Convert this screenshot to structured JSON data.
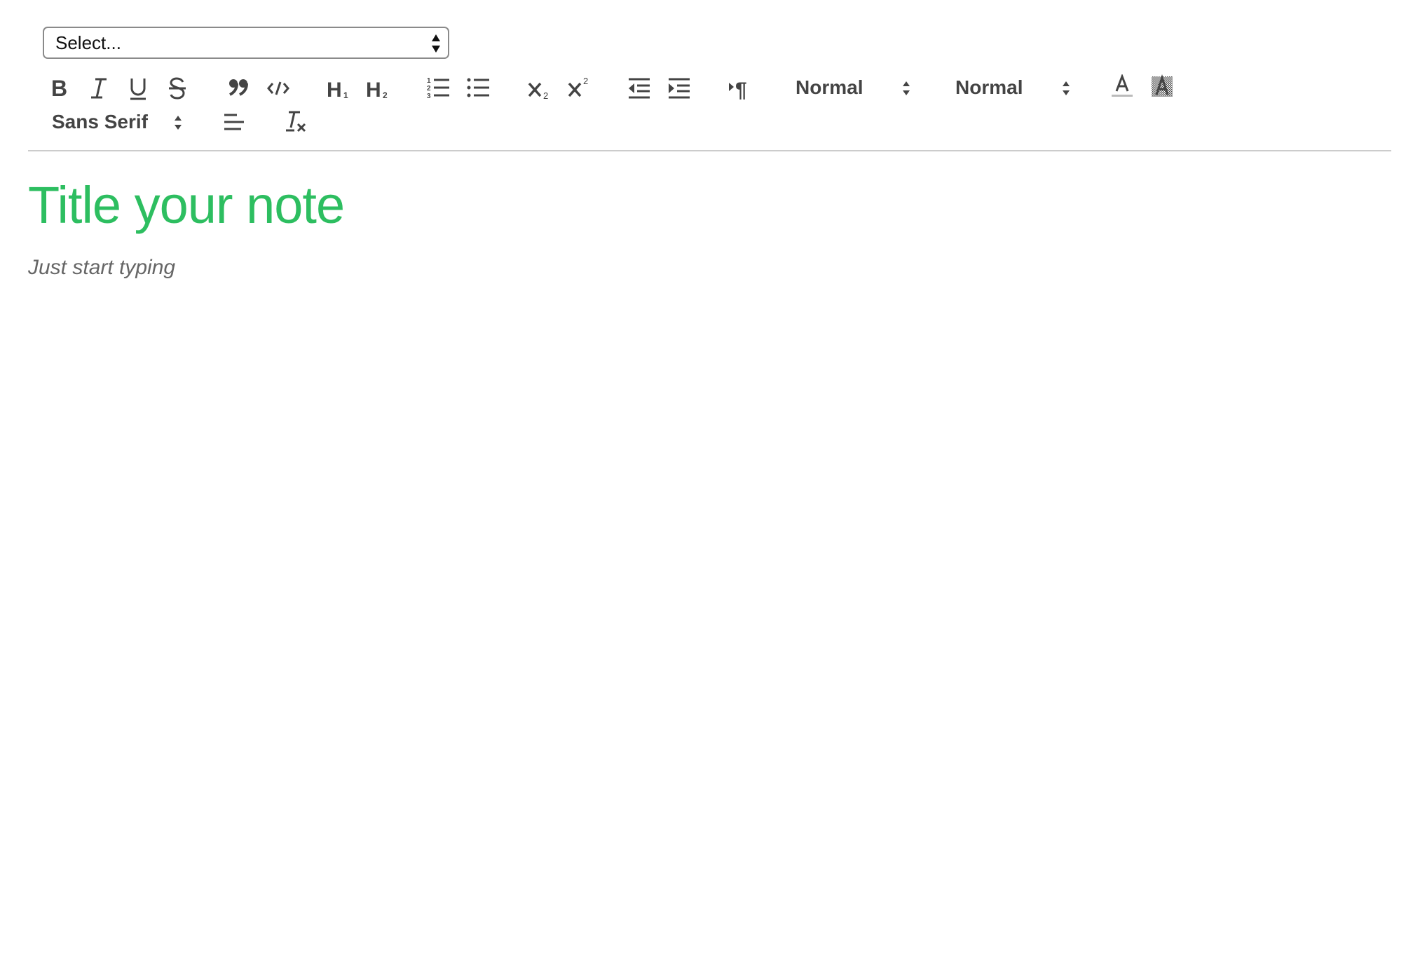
{
  "notebook_select": {
    "selected": "Select..."
  },
  "toolbar": {
    "header_size": "Normal",
    "font_size": "Normal",
    "font_family": "Sans Serif",
    "icons": [
      "bold-icon",
      "italic-icon",
      "underline-icon",
      "strikethrough-icon",
      "blockquote-icon",
      "code-block-icon",
      "header-1-icon",
      "header-2-icon",
      "ordered-list-icon",
      "bullet-list-icon",
      "subscript-icon",
      "superscript-icon",
      "outdent-icon",
      "indent-icon",
      "text-direction-icon",
      "font-color-icon",
      "background-color-icon",
      "align-icon",
      "clean-formatting-icon"
    ]
  },
  "editor": {
    "title_placeholder": "Title your note",
    "body_placeholder": "Just start typing"
  },
  "colors": {
    "accent": "#2dbe60",
    "icon": "#444444",
    "placeholder": "#666666",
    "divider": "#cccccc"
  }
}
